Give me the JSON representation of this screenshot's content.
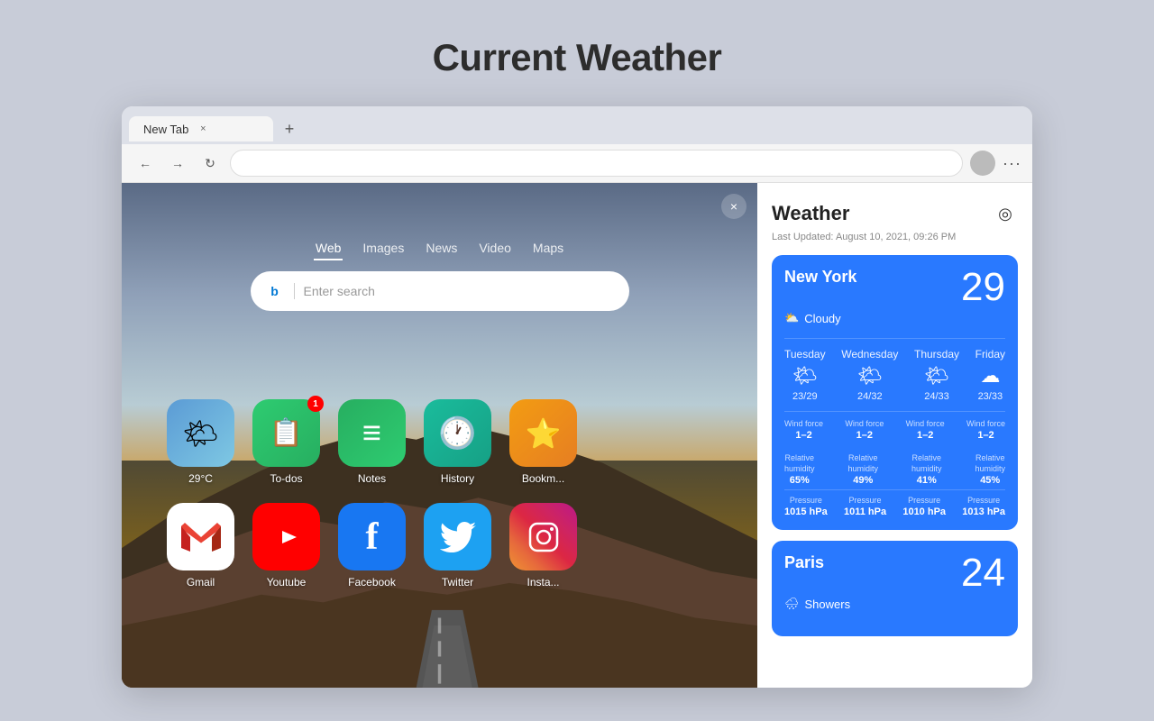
{
  "page": {
    "title": "Current Weather"
  },
  "browser": {
    "tab_label": "New Tab",
    "tab_close": "×",
    "tab_add": "+"
  },
  "nav": {
    "back_icon": "←",
    "forward_icon": "→",
    "refresh_icon": "↻",
    "address_placeholder": "",
    "more_icon": "···"
  },
  "new_tab": {
    "close_icon": "×",
    "search_tabs": [
      "Web",
      "Images",
      "News",
      "Video",
      "Maps"
    ],
    "active_tab_index": 0,
    "search_placeholder": "Enter search",
    "bing_label": "b"
  },
  "app_row1": [
    {
      "id": "weather",
      "label": "29°C",
      "emoji": "🌤",
      "color_class": "app-weather",
      "badge": null
    },
    {
      "id": "todo",
      "label": "To-dos",
      "emoji": "📋",
      "color_class": "app-todo",
      "badge": "1"
    },
    {
      "id": "notes",
      "label": "Notes",
      "emoji": "📗",
      "color_class": "app-notes",
      "badge": null
    },
    {
      "id": "history",
      "label": "History",
      "emoji": "🕐",
      "color_class": "app-history",
      "badge": null
    },
    {
      "id": "bookmarks",
      "label": "Bookmarks",
      "emoji": "⭐",
      "color_class": "app-bookmarks",
      "badge": null
    }
  ],
  "app_row2": [
    {
      "id": "gmail",
      "label": "Gmail",
      "emoji": "✉",
      "color_class": "app-gmail",
      "badge": null
    },
    {
      "id": "youtube",
      "label": "Youtube",
      "emoji": "▶",
      "color_class": "app-youtube",
      "badge": null
    },
    {
      "id": "facebook",
      "label": "Facebook",
      "emoji": "f",
      "color_class": "app-facebook",
      "badge": null
    },
    {
      "id": "twitter",
      "label": "Twitter",
      "emoji": "🐦",
      "color_class": "app-twitter",
      "badge": null
    },
    {
      "id": "instagram",
      "label": "Instagram",
      "emoji": "📷",
      "color_class": "app-instagram",
      "badge": null
    }
  ],
  "weather_panel": {
    "title": "Weather",
    "location_icon": "◎",
    "last_updated": "Last Updated: August 10, 2021, 09:26 PM",
    "cities": [
      {
        "name": "New York",
        "temp": "29",
        "condition": "Cloudy",
        "condition_icon": "⛅",
        "forecast": [
          {
            "day": "Tuesday",
            "icon": "🌤",
            "temp": "23/29",
            "wind": "1–2",
            "humidity": "65%",
            "pressure": "1015 hPa"
          },
          {
            "day": "Wednesday",
            "icon": "🌤",
            "temp": "24/32",
            "wind": "1–2",
            "humidity": "49%",
            "pressure": "1011 hPa"
          },
          {
            "day": "Thursday",
            "icon": "🌤",
            "temp": "24/33",
            "wind": "1–2",
            "humidity": "41%",
            "pressure": "1010 hPa"
          },
          {
            "day": "Friday",
            "icon": "☁",
            "temp": "23/33",
            "wind": "1–2",
            "humidity": "45%",
            "pressure": "1013 hPa"
          }
        ]
      },
      {
        "name": "Paris",
        "temp": "24",
        "condition": "Showers",
        "condition_icon": "🌧"
      }
    ]
  }
}
